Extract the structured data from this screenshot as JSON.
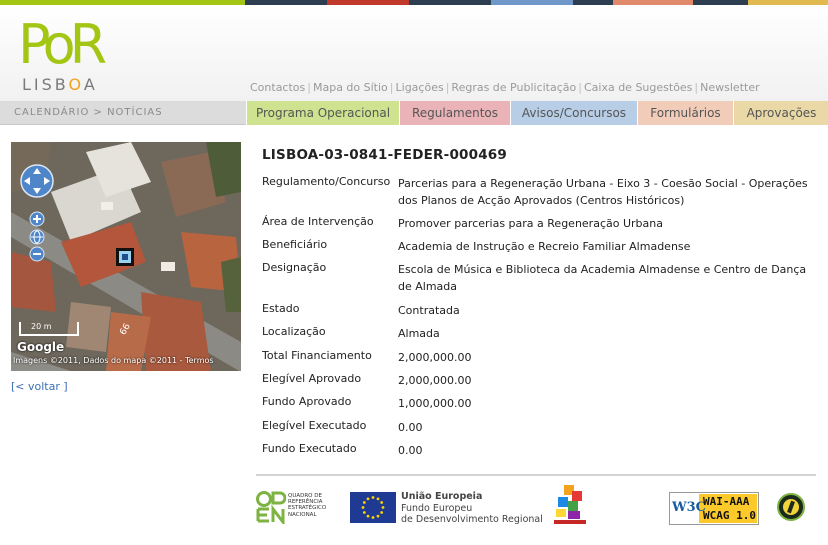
{
  "colors": {
    "strip": [
      "#a3c614",
      "#2c3e50",
      "#c0392b",
      "#2c3e50",
      "#6f97c9",
      "#2c3e50",
      "#e08a6b",
      "#2c3e50",
      "#e0b94f"
    ],
    "logo_green": "#a3c614",
    "logo_orange": "#f3a21b",
    "link_blue": "#3b6fb6"
  },
  "logo": {
    "word_top": "PoR",
    "word_bottom": "LISBOA"
  },
  "header_links": [
    "Contactos",
    "Mapa do Sítio",
    "Ligações",
    "Regras de Publicitação",
    "Caixa de Sugestões",
    "Newsletter"
  ],
  "breadcrumb": "CALENDÁRIO > NOTÍCIAS",
  "tabs": [
    "Programa Operacional",
    "Regulamentos",
    "Avisos/Concursos",
    "Formulários",
    "Aprovações"
  ],
  "map": {
    "scale": "20 m",
    "attribution": "Imagens ©2011, Dados do mapa ©2011 - Termos",
    "brand": "Google",
    "street_number": "66",
    "icons": [
      "pan-control-icon",
      "zoom-in-icon",
      "globe-icon",
      "zoom-out-icon",
      "map-marker-icon"
    ]
  },
  "back_link": "[< voltar ]",
  "project": {
    "code": "LISBOA-03-0841-FEDER-000469",
    "fields": [
      {
        "label": "Regulamento/Concurso",
        "value": "Parcerias para a Regeneração Urbana - Eixo 3 - Coesão Social - Operações dos Planos de Acção Aprovados (Centros Históricos)"
      },
      {
        "label": "Área de Intervenção",
        "value": "Promover parcerias para a Regeneração Urbana"
      },
      {
        "label": "Beneficiário",
        "value": "Academia de Instrução e Recreio Familiar Almadense"
      },
      {
        "label": "Designação",
        "value": "Escola de Música e Biblioteca da Academia Almadense e Centro de Dança de Almada"
      },
      {
        "label": "Estado",
        "value": "Contratada"
      },
      {
        "label": "Localização",
        "value": "Almada"
      },
      {
        "label": "Total Financiamento",
        "value": "2,000,000.00"
      },
      {
        "label": "Elegível Aprovado",
        "value": "2,000,000.00"
      },
      {
        "label": "Fundo Aprovado",
        "value": "1,000,000.00"
      },
      {
        "label": "Elegível Executado",
        "value": "0.00"
      },
      {
        "label": "Fundo Executado",
        "value": "0.00"
      }
    ]
  },
  "footer": {
    "qren_lines": [
      "Quadro de",
      "Referência",
      "Estratégico",
      "Nacional"
    ],
    "eu_title": "União Europeia",
    "eu_line1": "Fundo Europeu",
    "eu_line2": "de Desenvolvimento Regional",
    "w3c_text": "W3C",
    "wcag_line1": "WAI-AAA",
    "wcag_line2": "WCAG 1.0"
  }
}
